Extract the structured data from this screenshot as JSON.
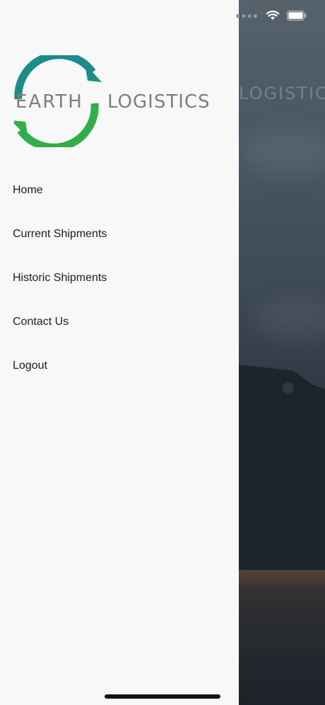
{
  "status_bar": {
    "signal_icon": "signal-dots-icon",
    "wifi_icon": "wifi-icon",
    "battery_icon": "battery-icon"
  },
  "drawer": {
    "logo": {
      "word1": "EARTH",
      "word2": "LOGISTICS",
      "colors": {
        "teal": "#1c8c8a",
        "green": "#2fae4a",
        "text": "#7d7d7d"
      }
    },
    "menu": [
      {
        "label": "Home"
      },
      {
        "label": "Current Shipments"
      },
      {
        "label": "Historic Shipments"
      },
      {
        "label": "Contact Us"
      },
      {
        "label": "Logout"
      }
    ]
  },
  "background": {
    "logo_text": "LOGISTICS"
  }
}
